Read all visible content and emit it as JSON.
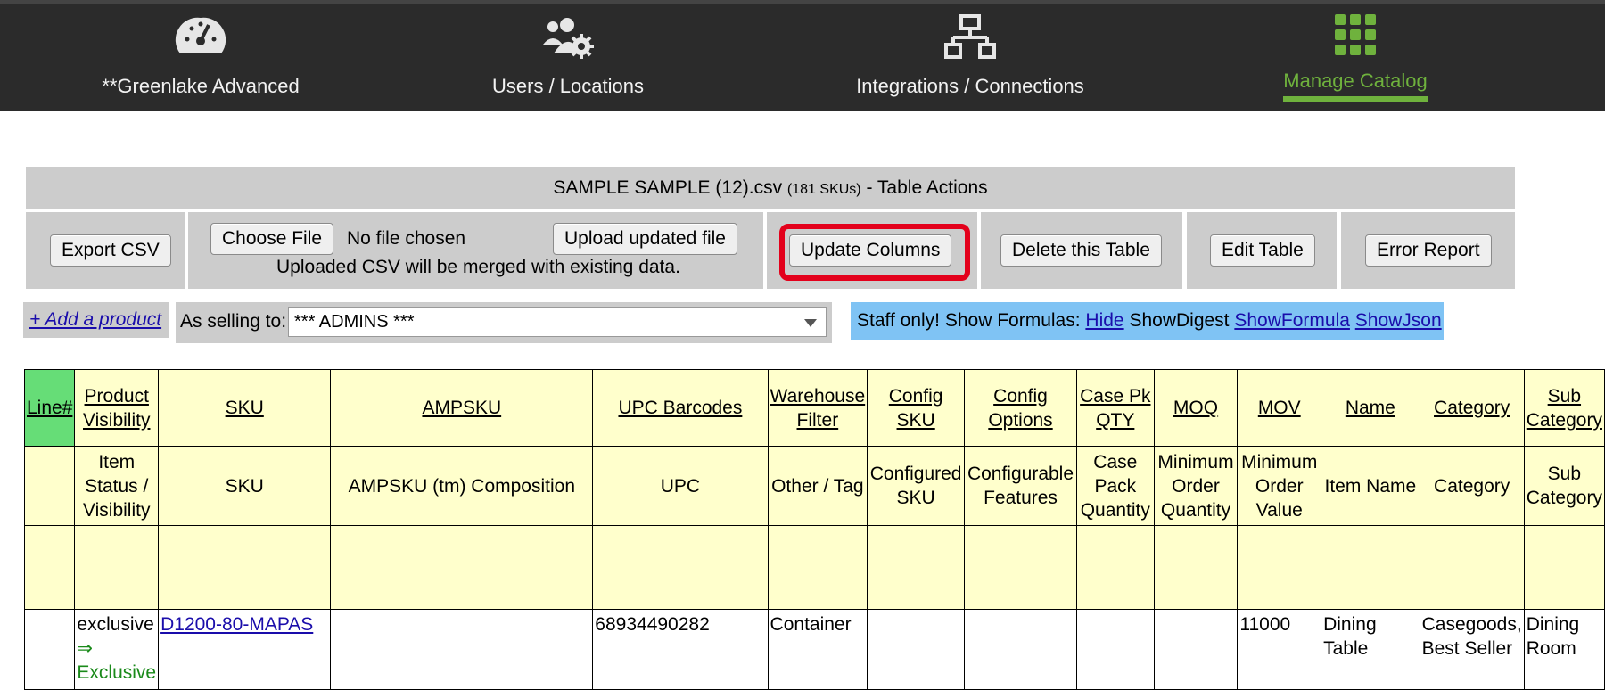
{
  "nav": {
    "items": [
      {
        "label": "**Greenlake Advanced",
        "icon": "dashboard-gauge-icon"
      },
      {
        "label": "Users / Locations",
        "icon": "users-gear-icon"
      },
      {
        "label": "Integrations / Connections",
        "icon": "network-icon"
      },
      {
        "label": "Manage Catalog",
        "icon": "grid-icon",
        "active": true
      }
    ],
    "accent_color": "#6fb23d"
  },
  "table_actions": {
    "filename": "SAMPLE SAMPLE (12).csv",
    "sku_count": "(181 SKUs)",
    "suffix": "- Table Actions",
    "export_csv": "Export CSV",
    "choose_file": "Choose File",
    "no_file": "No file chosen",
    "upload": "Upload updated file",
    "merge_note": "Uploaded CSV will be merged with existing data.",
    "update_columns": "Update Columns",
    "delete_table": "Delete this Table",
    "edit_table": "Edit Table",
    "error_report": "Error Report"
  },
  "toolbar": {
    "add_product": "+ Add a product",
    "selling_label": "As selling to:",
    "selling_value": "*** ADMINS ***",
    "staff_label": "Staff only! Show Formulas:",
    "hide": "Hide",
    "show_digest": "ShowDigest",
    "show_formula": "ShowFormula",
    "show_json": "ShowJson"
  },
  "table": {
    "headers": [
      "Line#",
      "Product Visibility",
      "SKU",
      "AMPSKU",
      "UPC Barcodes",
      "Warehouse Filter",
      "Config SKU",
      "Config Options",
      "Case Pk QTY",
      "MOQ",
      "MOV",
      "Name",
      "Category",
      "Sub Category"
    ],
    "subheaders": [
      "",
      "Item Status / Visibility",
      "SKU",
      "AMPSKU (tm) Composition",
      "UPC",
      "Other / Tag",
      "Configured SKU",
      "Configurable Features",
      "Case Pack Quantity",
      "Minimum Order Quantity",
      "Minimum Order Value",
      "Item Name",
      "Category",
      "Sub Category"
    ],
    "row1": {
      "visibility": "exclusive",
      "arrow": "⇒",
      "visibility_status": "Exclusive",
      "sku": "D1200-80-MAPAS",
      "ampsku": "",
      "upc": "68934490282",
      "warehouse": "Container",
      "config_sku": "",
      "config_options": "",
      "case_pk": "",
      "moq": "",
      "mov": "11000",
      "name": "Dining Table",
      "category": "Casegoods, Best Seller",
      "sub_category": "Dining Room"
    }
  }
}
